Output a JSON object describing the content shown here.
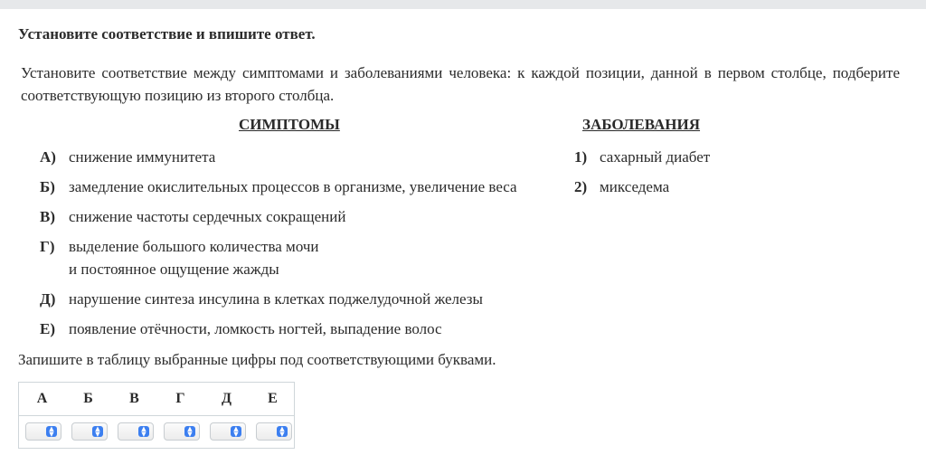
{
  "task": {
    "header": "Установите соответствие и впишите ответ.",
    "text": "Установите соответствие между симптомами и заболеваниями человека: к каждой позиции, данной в первом столбце, подберите соответствующую позицию из второго столбца."
  },
  "columns": {
    "left_title": "СИМПТОМЫ",
    "right_title": "ЗАБОЛЕВАНИЯ"
  },
  "symptoms": [
    {
      "letter": "А)",
      "line1": "снижение иммунитета",
      "line2": ""
    },
    {
      "letter": "Б)",
      "line1": "замедление окислительных процессов в организме, увеличение веса",
      "line2": ""
    },
    {
      "letter": "В)",
      "line1": "снижение частоты сердечных сокращений",
      "line2": ""
    },
    {
      "letter": "Г)",
      "line1": "выделение большого количества мочи",
      "line2": "и постоянное ощущение жажды"
    },
    {
      "letter": "Д)",
      "line1": "нарушение синтеза инсулина в клетках поджелудочной железы",
      "line2": ""
    },
    {
      "letter": "Е)",
      "line1": "появление отёчности, ломкость ногтей, выпадение волос",
      "line2": ""
    }
  ],
  "diseases": [
    {
      "number": "1)",
      "text": "сахарный диабет"
    },
    {
      "number": "2)",
      "text": "микседема"
    }
  ],
  "instruction": "Запишите в таблицу выбранные цифры под соответствующими буквами.",
  "answer_table": {
    "headers": [
      "А",
      "Б",
      "В",
      "Г",
      "Д",
      "Е"
    ],
    "values": [
      "",
      "",
      "",
      "",
      "",
      ""
    ],
    "accent_color": "#3c7ff0"
  }
}
